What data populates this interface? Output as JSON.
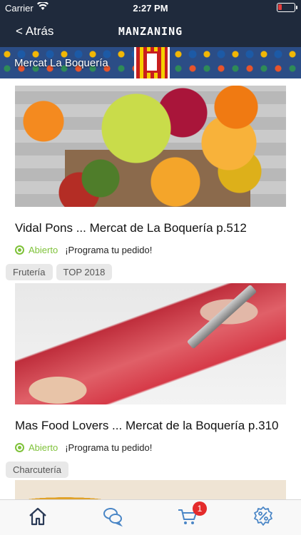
{
  "status_bar": {
    "carrier": "Carrier",
    "time": "2:27 PM"
  },
  "nav": {
    "back_label": "< Atrás",
    "logo": "MANZANING"
  },
  "banner": {
    "title": "Mercat La Boquería"
  },
  "stores": [
    {
      "name": "Vidal Pons ... Mercat de La Boquería p.512",
      "status": "Abierto",
      "order": "¡Programa tu pedido!",
      "tags": [
        "Frutería",
        "TOP 2018"
      ]
    },
    {
      "name": "Mas Food Lovers ... Mercat de la Boquería p.310",
      "status": "Abierto",
      "order": "¡Programa tu pedido!",
      "tags": [
        "Charcutería"
      ]
    }
  ],
  "tabbar": {
    "cart_badge": "1",
    "items": [
      "home-icon",
      "chat-icon",
      "cart-icon",
      "discount-icon"
    ]
  },
  "colors": {
    "nav_bg": "#1f2a3c",
    "open_green": "#7fc23a",
    "badge_red": "#e42b2b",
    "icon_navy": "#2a3a56",
    "icon_blue": "#4a86c6"
  }
}
